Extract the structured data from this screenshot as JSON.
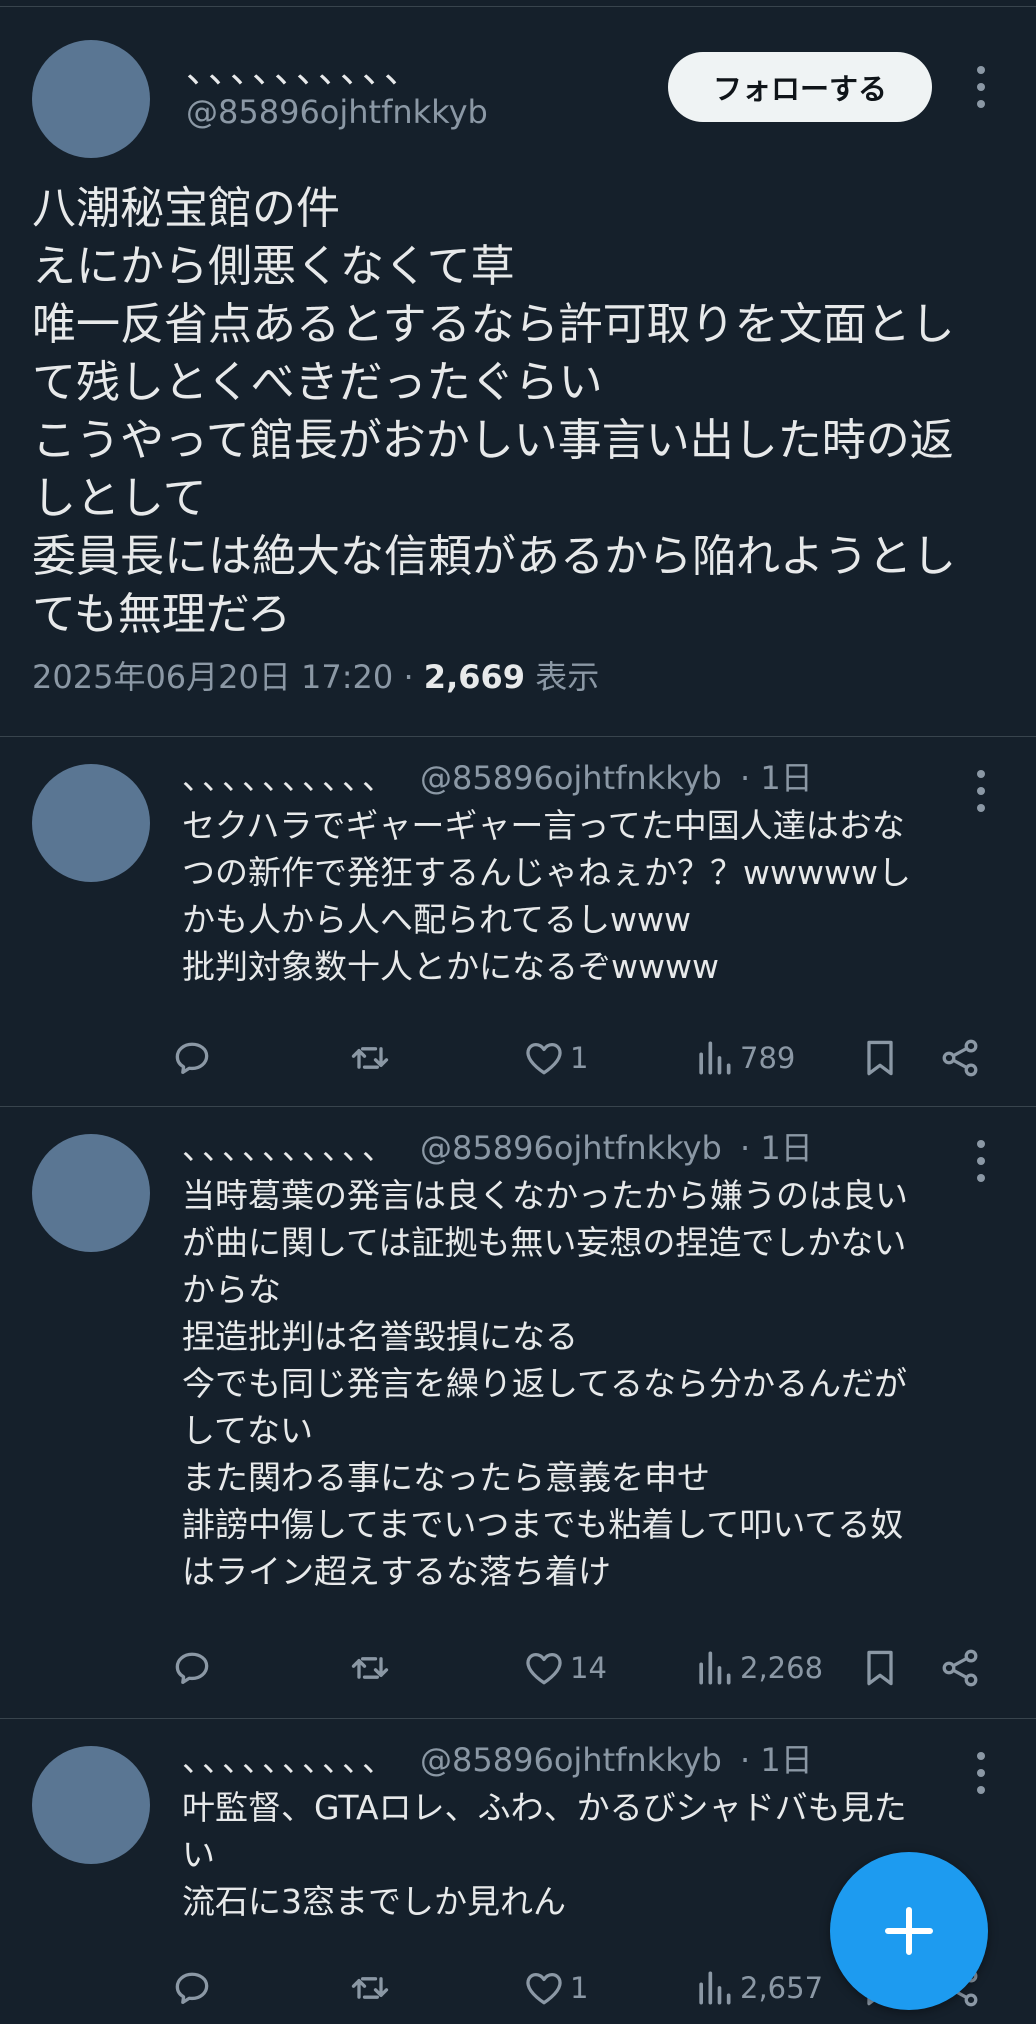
{
  "main_tweet": {
    "name": "、、、、、、、、、、",
    "handle": "@85896ojhtfnkkyb",
    "follow_label": "フォローする",
    "lines": [
      "八潮秘宝館の件",
      "えにから側悪くなくて草",
      "唯一反省点あるとするなら許可取りを文面とし",
      "て残しとくべきだったぐらい",
      "こうやって館長がおかしい事言い出した時の返",
      "しとして",
      "委員長には絶大な信頼があるから陥れようとし",
      "ても無理だろ"
    ],
    "timestamp": "2025年06月20日 17:20",
    "separator": "·",
    "views": "2,669",
    "views_label": "表示"
  },
  "replies": [
    {
      "name": "、、、、、、、、、、",
      "handle": "@85896ojhtfnkkyb",
      "time": "· 1日",
      "lines": [
        "セクハラでギャーギャー言ってた中国人達はおな",
        "つの新作で発狂するんじゃねぇか？？wwwwwし",
        "かも人から人へ配られてるしwww",
        "批判対象数十人とかになるぞwwww"
      ],
      "replies": "",
      "reposts": "",
      "likes": "1",
      "views": "789"
    },
    {
      "name": "、、、、、、、、、、",
      "handle": "@85896ojhtfnkkyb",
      "time": "· 1日",
      "lines": [
        "当時葛葉の発言は良くなかったから嫌うのは良い",
        "が曲に関しては証拠も無い妄想の捏造でしかない",
        "からな",
        "捏造批判は名誉毀損になる",
        "今でも同じ発言を繰り返してるなら分かるんだが",
        "してない",
        "また関わる事になったら意義を申せ",
        "誹謗中傷してまでいつまでも粘着して叩いてる奴",
        "はライン超えするな落ち着け"
      ],
      "replies": "",
      "reposts": "",
      "likes": "14",
      "views": "2,268"
    },
    {
      "name": "、、、、、、、、、、",
      "handle": "@85896ojhtfnkkyb",
      "time": "· 1日",
      "lines": [
        "叶監督、GTAロレ、ふわ、かるびシャドバも見た",
        "い",
        "流石に3窓までしか見れん"
      ],
      "replies": "",
      "reposts": "",
      "likes": "1",
      "views": "2,657"
    }
  ],
  "icons": {
    "more": "more-vertical-icon",
    "reply": "reply-icon",
    "repost": "repost-icon",
    "like": "heart-icon",
    "views": "analytics-icon",
    "bookmark": "bookmark-icon",
    "share": "share-icon",
    "compose": "plus-icon"
  },
  "colors": {
    "background": "#15202b",
    "text": "#e7e9ea",
    "secondary": "#8b98a5",
    "divider": "#38444d",
    "accent": "#1d9bf0",
    "avatar": "#5a7693"
  }
}
